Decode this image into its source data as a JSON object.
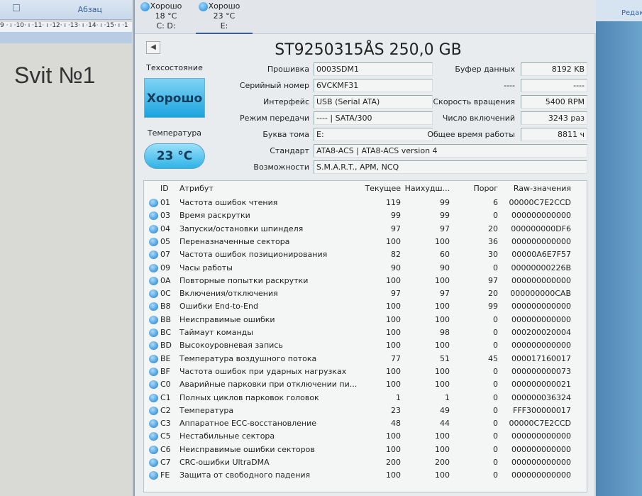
{
  "word": {
    "ribbon_group": "Абзац",
    "ruler": "9 · ı ·10· ı ·11· ı ·12· ı ·13· ı ·14· ı ·15· ı ·1",
    "doc_text": "Svit №1",
    "right_ribbon": "Редак"
  },
  "tabs": [
    {
      "status": "Хорошо",
      "temp": "18 °C",
      "drive": "C: D:"
    },
    {
      "status": "Хорошо",
      "temp": "23 °C",
      "drive": "E:"
    }
  ],
  "back_icon": "◀",
  "title": "ST9250315ÅS 250,0 GB",
  "health": {
    "label": "Техсостояние",
    "value": "Хорошо",
    "color": "#1ba4de"
  },
  "temperature": {
    "label": "Температура",
    "value": "23 °C"
  },
  "info_left": [
    {
      "label": "Прошивка",
      "value": "0003SDM1"
    },
    {
      "label": "Серийный номер",
      "value": "6VCKMF31"
    },
    {
      "label": "Интерфейс",
      "value": "USB (Serial ATA)"
    },
    {
      "label": "Режим передачи",
      "value": "---- | SATA/300"
    },
    {
      "label": "Буква тома",
      "value": "E:"
    }
  ],
  "info_right": [
    {
      "label": "Буфер данных",
      "value": "8192 KB"
    },
    {
      "label": "----",
      "value": "----"
    },
    {
      "label": "Скорость вращения",
      "value": "5400 RPM"
    },
    {
      "label": "Число включений",
      "value": "3243 раз"
    },
    {
      "label": "Общее время работы",
      "value": "8811 ч"
    }
  ],
  "info_wide": [
    {
      "label": "Стандарт",
      "value": "ATA8-ACS | ATA8-ACS version 4"
    },
    {
      "label": "Возможности",
      "value": "S.M.A.R.T., APM, NCQ"
    }
  ],
  "smart": {
    "headers": {
      "id": "ID",
      "attr": "Атрибут",
      "cur": "Текущее",
      "worst": "Наихудш...",
      "thr": "Порог",
      "raw": "Raw-значения"
    },
    "rows": [
      [
        "01",
        "Частота ошибок чтения",
        "119",
        "99",
        "6",
        "00000C7E2CCD"
      ],
      [
        "03",
        "Время раскрутки",
        "99",
        "99",
        "0",
        "000000000000"
      ],
      [
        "04",
        "Запуски/остановки шпинделя",
        "97",
        "97",
        "20",
        "000000000DF6"
      ],
      [
        "05",
        "Переназначенные сектора",
        "100",
        "100",
        "36",
        "000000000000"
      ],
      [
        "07",
        "Частота ошибок позиционирования",
        "82",
        "60",
        "30",
        "00000A6E7F57"
      ],
      [
        "09",
        "Часы работы",
        "90",
        "90",
        "0",
        "00000000226B"
      ],
      [
        "0A",
        "Повторные попытки раскрутки",
        "100",
        "100",
        "97",
        "000000000000"
      ],
      [
        "0C",
        "Включения/отключения",
        "97",
        "97",
        "20",
        "000000000CAB"
      ],
      [
        "B8",
        "Ошибки End-to-End",
        "100",
        "100",
        "99",
        "000000000000"
      ],
      [
        "BB",
        "Неисправимые ошибки",
        "100",
        "100",
        "0",
        "000000000000"
      ],
      [
        "BC",
        "Таймаут команды",
        "100",
        "98",
        "0",
        "000200020004"
      ],
      [
        "BD",
        "Высокоуровневая запись",
        "100",
        "100",
        "0",
        "000000000000"
      ],
      [
        "BE",
        "Температура воздушного потока",
        "77",
        "51",
        "45",
        "000017160017"
      ],
      [
        "BF",
        "Частота ошибок при ударных нагрузках",
        "100",
        "100",
        "0",
        "000000000073"
      ],
      [
        "C0",
        "Аварийные парковки при отключении пи...",
        "100",
        "100",
        "0",
        "000000000021"
      ],
      [
        "C1",
        "Полных циклов парковок головок",
        "1",
        "1",
        "0",
        "000000036324"
      ],
      [
        "C2",
        "Температура",
        "23",
        "49",
        "0",
        "FFF300000017"
      ],
      [
        "C3",
        "Аппаратное ECC-восстановление",
        "48",
        "44",
        "0",
        "00000C7E2CCD"
      ],
      [
        "C5",
        "Нестабильные сектора",
        "100",
        "100",
        "0",
        "000000000000"
      ],
      [
        "C6",
        "Неисправимые ошибки секторов",
        "100",
        "100",
        "0",
        "000000000000"
      ],
      [
        "C7",
        "CRC-ошибки UltraDMA",
        "200",
        "200",
        "0",
        "000000000000"
      ],
      [
        "FE",
        "Защита от свободного падения",
        "100",
        "100",
        "0",
        "000000000000"
      ]
    ]
  }
}
